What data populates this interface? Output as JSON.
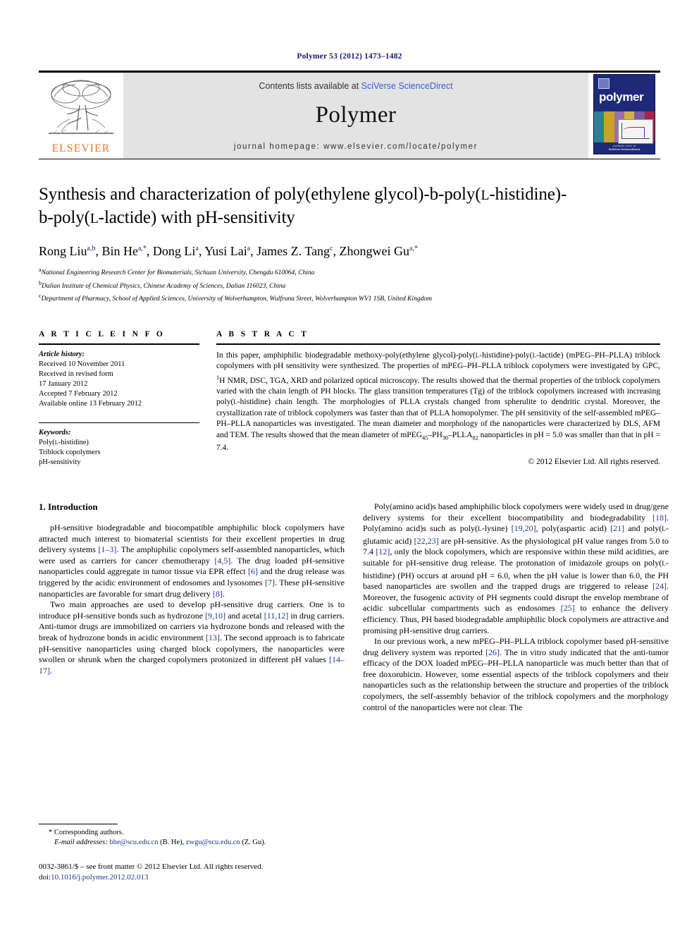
{
  "running_head": "Polymer 53 (2012) 1473–1482",
  "masthead": {
    "contents_prefix": "Contents lists available at ",
    "sciencedirect": "SciVerse ScienceDirect",
    "journal_title": "Polymer",
    "journal_homepage": "journal homepage: www.elsevier.com/locate/polymer",
    "publisher_wordmark": "ELSEVIER",
    "cover_title": "polymer",
    "cover_footer_line1": "Available online at",
    "cover_footer_line2": "SciVerse ScienceDirect",
    "colors": {
      "elsevier_orange": "#E87722",
      "link_blue": "#3a5fcd",
      "cover_navy": "#1e2a78",
      "masthead_gray": "#e3e3e3"
    }
  },
  "article": {
    "title_line1": "Synthesis and characterization of poly(ethylene glycol)-b-poly(L-histidine)-",
    "title_line2": "b-poly(L-lactide) with pH-sensitivity",
    "authors_text": "Rong Liu a,b, Bin He a,*, Dong Li a, Yusi Lai a, James Z. Tang c, Zhongwei Gu a,*",
    "authors": [
      {
        "name": "Rong Liu",
        "marks": "a,b"
      },
      {
        "name": "Bin He",
        "marks": "a,*"
      },
      {
        "name": "Dong Li",
        "marks": "a"
      },
      {
        "name": "Yusi Lai",
        "marks": "a"
      },
      {
        "name": "James Z. Tang",
        "marks": "c"
      },
      {
        "name": "Zhongwei Gu",
        "marks": "a,*"
      }
    ],
    "affiliations": [
      {
        "mark": "a",
        "text": "National Engineering Research Center for Biomaterials, Sichuan University, Chengdu 610064, China"
      },
      {
        "mark": "b",
        "text": "Dalian Institute of Chemical Physics, Chinese Academy of Sciences, Dalian 116023, China"
      },
      {
        "mark": "c",
        "text": "Department of Pharmacy, School of Applied Sciences, University of Wolverhampton, Wulfruna Street, Wolverhampton WV1 1SB, United Kingdom"
      }
    ]
  },
  "article_info": {
    "heading": "A R T I C L E  I N F O",
    "history_label": "Article history:",
    "history": [
      "Received 10 November 2011",
      "Received in revised form",
      "17 January 2012",
      "Accepted 7 February 2012",
      "Available online 13 February 2012"
    ],
    "keywords_label": "Keywords:",
    "keywords": [
      "Poly(L-histidine)",
      "Triblock copolymers",
      "pH-sensitivity"
    ]
  },
  "abstract": {
    "heading": "A B S T R A C T",
    "text_part1": "In this paper, amphiphilic biodegradable methoxy-poly(ethylene glycol)-poly(",
    "text_smallcap1": "L",
    "text_part2": "-histidine)-poly(",
    "text_smallcap2": "L",
    "text_part3": "-lactide) (mPEG–PH–PLLA) triblock copolymers with pH sensitivity were synthesized. The properties of mPEG–PH–PLLA triblock copolymers were investigated by GPC, ",
    "nmr_sup": "1",
    "text_part4": "H NMR, DSC, TGA, XRD and polarized optical microscopy. The results showed that the thermal properties of the triblock copolymers varied with the chain length of PH blocks. The glass transition temperatures (Tg) of the triblock copolymers increased with increasing poly(",
    "text_smallcap3": "L",
    "text_part5": "-histidine) chain length. The morphologies of PLLA crystals changed from spherulite to dendritic crystal. Moreover, the crystallization rate of triblock copolymers was faster than that of PLLA homopolymer. The pH sensitivity of the self-assembled mPEG–PH–PLLA nanoparticles was investigated. The mean diameter and morphology of the nanoparticles were characterized by DLS, AFM and TEM. The results showed that the mean diameter of mPEG",
    "sub1": "45",
    "text_part6": "–PH",
    "sub2": "30",
    "text_part7": "–PLLA",
    "sub3": "82",
    "text_part8": " nanoparticles in pH = 5.0 was smaller than that in pH = 7.4.",
    "copyright": "© 2012 Elsevier Ltd. All rights reserved."
  },
  "body": {
    "section_number_title": "1. Introduction",
    "left_paragraphs": [
      "pH-sensitive biodegradable and biocompatible amphiphilic block copolymers have attracted much interest to biomaterial scientists for their excellent properties in drug delivery systems [1–3]. The amphiphilic copolymers self-assembled nanoparticles, which were used as carriers for cancer chemotherapy [4,5]. The drug loaded pH-sensitive nanoparticles could aggregate in tumor tissue via EPR effect [6] and the drug release was triggered by the acidic environment of endosomes and lysosomes [7]. These pH-sensitive nanoparticles are favorable for smart drug delivery [8].",
      "Two main approaches are used to develop pH-sensitive drug carriers. One is to introduce pH-sensitive bonds such as hydrozone [9,10] and acetal [11,12] in drug carriers. Anti-tumor drugs are immobilized on carriers via hydrozone bonds and released with the break of hydrozone bonds in acidic environment [13]. The second approach is to fabricate pH-sensitive nanoparticles using charged block copolymers, the nanoparticles were swollen or shrunk when the charged copolymers protonized in different pH values [14–17]."
    ],
    "right_paragraphs": [
      "Poly(amino acid)s based amphiphilic block copolymers were widely used in drug/gene delivery systems for their excellent biocompatibility and biodegradability [18]. Poly(amino acid)s such as poly(L-lysine) [19,20], poly(aspartic acid) [21] and poly(L-glutamic acid) [22,23] are pH-sensitive. As the physiological pH value ranges from 5.0 to 7.4 [12], only the block copolymers, which are responsive within these mild acidities, are suitable for pH-sensitive drug release. The protonation of imidazole groups on poly(L-histidine) (PH) occurs at around pH = 6.0, when the pH value is lower than 6.0, the PH based nanoparticles are swollen and the trapped drugs are triggered to release [24]. Moreover, the fusogenic activity of PH segments could disrupt the envelop membrane of acidic subcellular compartments such as endosomes [25] to enhance the delivery efficiency. Thus, PH based biodegradable amphiphilic block copolymers are attractive and promising pH-sensitive drug carriers.",
      "In our previous work, a new mPEG–PH–PLLA triblock copolymer based pH-sensitive drug delivery system was reported [26]. The in vitro study indicated that the anti-tumor efficacy of the DOX loaded mPEG–PH–PLLA nanoparticle was much better than that of free doxorubicin. However, some essential aspects of the triblock copolymers and their nanoparticles such as the relationship between the structure and properties of the triblock copolymers, the self-assembly behavior of the triblock copolymers and the morphology control of the nanoparticles were not clear. The"
    ]
  },
  "footnote": {
    "corresponding": "* Corresponding authors.",
    "email_label": "E-mail addresses:",
    "email1": "bhe@scu.edu.cn",
    "email1_suffix": "(B. He),",
    "email2": "zwgu@scu.edu.cn",
    "email2_suffix": "(Z. Gu)."
  },
  "copyright_block": {
    "issn_line": "0032-3861/$ – see front matter © 2012 Elsevier Ltd. All rights reserved.",
    "doi_label": "doi:",
    "doi_value": "10.1016/j.polymer.2012.02.013"
  }
}
